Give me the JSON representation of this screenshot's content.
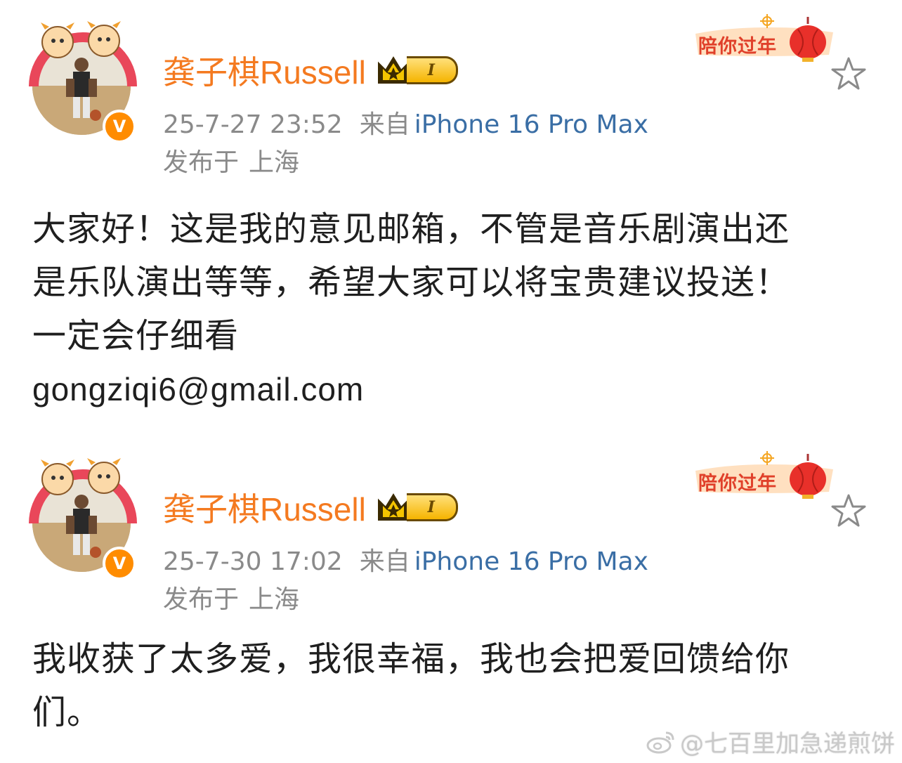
{
  "posts": [
    {
      "username": "龚子棋Russell",
      "vip_level": "I",
      "verified_mark": "V",
      "festival_badge": "陪你过年",
      "time": "25-7-27 23:52",
      "source_prefix": "来自",
      "device": "iPhone 16 Pro Max",
      "location_prefix": "发布于",
      "location": "上海",
      "content_lines": [
        "大家好！这是我的意见邮箱，不管是音乐剧演出还",
        "是乐队演出等等，希望大家可以将宝贵建议投送！",
        "一定会仔细看"
      ],
      "email": "gongziqi6@gmail.com"
    },
    {
      "username": "龚子棋Russell",
      "vip_level": "I",
      "verified_mark": "V",
      "festival_badge": "陪你过年",
      "time": "25-7-30 17:02",
      "source_prefix": "来自",
      "device": "iPhone 16 Pro Max",
      "location_prefix": "发布于",
      "location": "上海",
      "content_lines": [
        "我收获了太多爱，我很幸福，我也会把爱回馈给你",
        "们。"
      ]
    }
  ],
  "watermark": "@七百里加急递煎饼",
  "colors": {
    "username": "#f47a20",
    "device_link": "#3a6ea5",
    "meta_gray": "#8a8a8a",
    "verified_orange": "#ff8c00",
    "festival_red": "#e0402a"
  },
  "icons": {
    "star": "star-icon",
    "crown": "crown-icon",
    "lantern": "lantern-icon",
    "weibo": "weibo-logo-icon"
  }
}
